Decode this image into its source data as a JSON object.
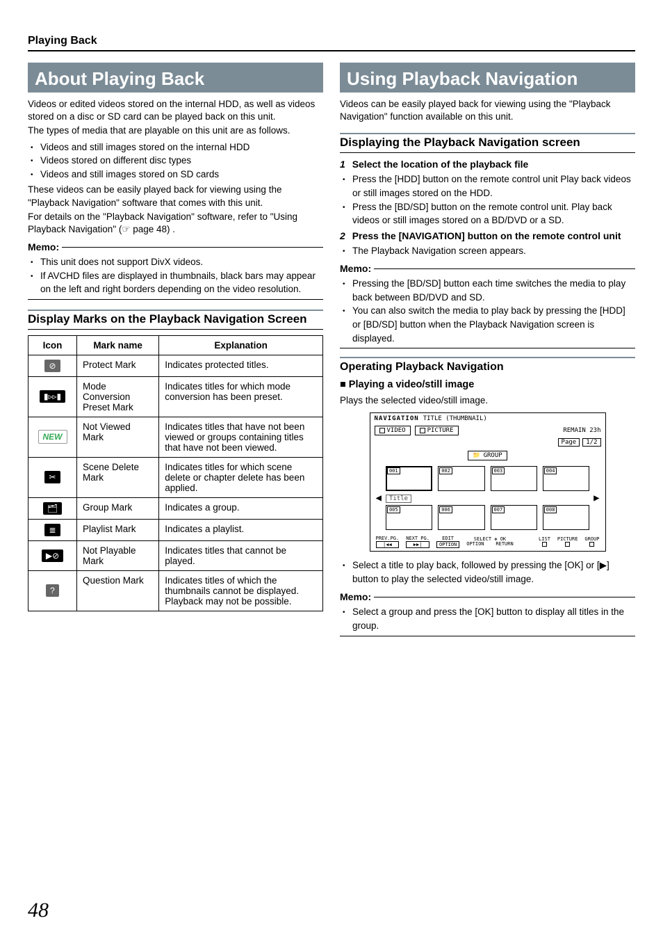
{
  "page_header": "Playing Back",
  "page_number": "48",
  "left": {
    "title": "About Playing Back",
    "p1": "Videos or edited videos stored on the internal HDD, as well as videos stored on a disc or SD card can be played back on this unit.",
    "p2": "The types of media that are playable on this unit are as follows.",
    "bullets1": [
      "Videos and still images stored on the internal HDD",
      "Videos stored on different disc types",
      "Videos and still images stored on SD cards"
    ],
    "p3": "These videos can be easily played back for viewing using the \"Playback Navigation\" software that comes with this unit.",
    "p4": "For details on the \"Playback Navigation\" software, refer to \"Using Playback Navigation\" (☞ page 48) .",
    "memo_label": "Memo:",
    "memo_items": [
      "This unit does not support DivX videos.",
      "If AVCHD files are displayed in thumbnails, black bars may appear on the left and right borders depending on the video resolution."
    ],
    "table_heading": "Display Marks on the Playback Navigation Screen",
    "table": {
      "headers": [
        "Icon",
        "Mark name",
        "Explanation"
      ],
      "rows": [
        {
          "icon_label": "protect-mark-icon",
          "icon_glyph": "⊘",
          "name": "Protect Mark",
          "expl": "Indicates protected titles."
        },
        {
          "icon_label": "mode-conversion-preset-icon",
          "icon_glyph": "▮▹▹▮",
          "name": "Mode Conversion Preset Mark",
          "expl": "Indicates titles for which mode conversion has been preset."
        },
        {
          "icon_label": "not-viewed-icon",
          "icon_glyph": "NEW",
          "name": "Not Viewed Mark",
          "expl": "Indicates titles that have not been viewed or groups containing titles that have not been viewed."
        },
        {
          "icon_label": "scene-delete-icon",
          "icon_glyph": "✂",
          "name": "Scene Delete Mark",
          "expl": "Indicates titles for which scene delete or chapter delete has been applied."
        },
        {
          "icon_label": "group-mark-icon",
          "icon_glyph": "🗂",
          "name": "Group Mark",
          "expl": "Indicates a group."
        },
        {
          "icon_label": "playlist-mark-icon",
          "icon_glyph": "≣",
          "name": "Playlist Mark",
          "expl": "Indicates a playlist."
        },
        {
          "icon_label": "not-playable-icon",
          "icon_glyph": "▶⊘",
          "name": "Not Playable Mark",
          "expl": "Indicates titles that cannot be played."
        },
        {
          "icon_label": "question-mark-icon",
          "icon_glyph": "?",
          "name": "Question Mark",
          "expl": "Indicates titles of which the thumbnails cannot be displayed. Playback may not be possible."
        }
      ]
    }
  },
  "right": {
    "title": "Using Playback Navigation",
    "p1": "Videos can be easily played back for viewing using the \"Playback Navigation\" function available on this unit.",
    "h2a": "Displaying the Playback Navigation screen",
    "step1": "Select the location of the playback file",
    "step1_items": [
      "Press the [HDD] button on the remote control unit Play back videos or still images stored on the HDD.",
      "Press the [BD/SD] button on the remote control unit. Play back videos or still images stored on a BD/DVD or a SD."
    ],
    "step2": "Press the [NAVIGATION] button on the remote control unit",
    "step2_items": [
      "The Playback Navigation screen appears."
    ],
    "memo_label": "Memo:",
    "memo_items": [
      "Pressing the [BD/SD] button each time switches the media to play back between BD/DVD and SD.",
      "You can also switch the media to play back by pressing the [HDD] or [BD/SD] button when the Playback Navigation screen is displayed."
    ],
    "h2b": "Operating Playback Navigation",
    "h3a": "Playing a video/still image",
    "p2": "Plays the selected video/still image.",
    "mock": {
      "nav": "NAVIGATION",
      "subtitle": "TITLE (THUMBNAIL)",
      "tab_video": "VIDEO",
      "tab_picture": "PICTURE",
      "remain": "REMAIN 23h",
      "page_label": "Page",
      "page_val": "1/2",
      "group": "GROUP",
      "title_tag": "Title",
      "thumb_labels": [
        "001",
        "002",
        "003",
        "004",
        "005",
        "006",
        "007",
        "008"
      ],
      "ft_prev": "PREV.PG.",
      "ft_next": "NEXT PG.",
      "ft_edit": "EDIT",
      "ft_select": "SELECT",
      "ft_option": "OPTION",
      "ft_ok": "OK",
      "ft_return": "RETURN",
      "ft_list": "LIST",
      "ft_picture": "PICTURE",
      "ft_group": "GROUP",
      "key_prev": "|◀◀",
      "key_next": "▶▶|",
      "key_option": "OPTION"
    },
    "after_mock_bullet": "Select a title to play back, followed by pressing the [OK] or [▶] button to play the selected video/still image.",
    "memo2_label": "Memo:",
    "memo2_items": [
      "Select a group and press the [OK] button to display all titles in the group."
    ]
  }
}
